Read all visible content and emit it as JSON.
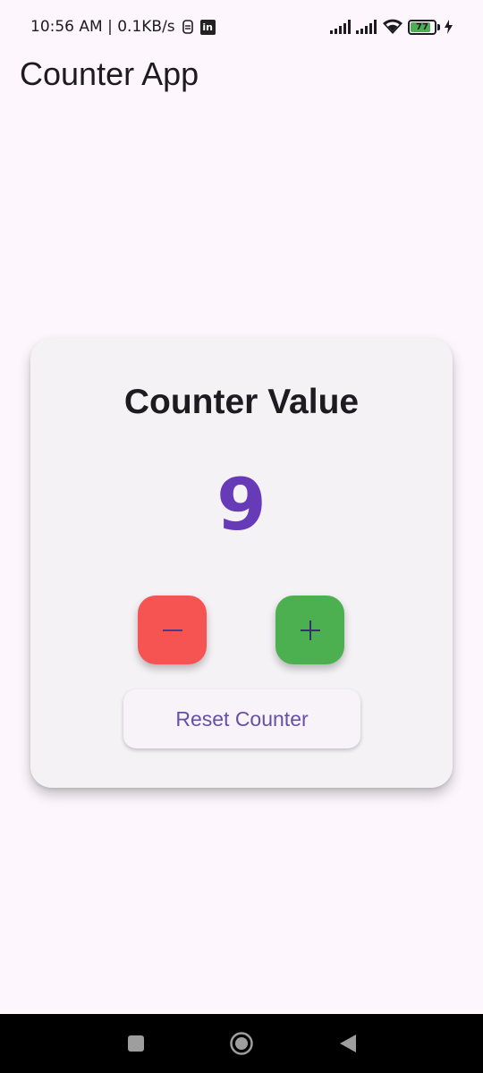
{
  "status_bar": {
    "time_and_speed": "10:56 AM | 0.1KB/s",
    "linkedin_glyph": "in",
    "battery_level": "77",
    "battery_fraction": 0.77,
    "icons": [
      "sim-icon",
      "linkedin-icon",
      "signal-icon",
      "signal-icon",
      "wifi-icon",
      "battery-icon",
      "charging-icon"
    ]
  },
  "app_bar": {
    "title": "Counter App"
  },
  "card": {
    "title": "Counter Value",
    "value": "9",
    "decrement_symbol": "−",
    "increment_symbol": "+",
    "reset_label": "Reset Counter"
  },
  "colors": {
    "background": "#fdf7fd",
    "card": "#f5f2f6",
    "value": "#673ab7",
    "decrement": "#f65353",
    "increment": "#4caf50",
    "reset_text": "#6750a4",
    "nav_bar": "#000000"
  },
  "nav_bar": {
    "icons": [
      "recent-apps-icon",
      "home-icon",
      "back-icon"
    ]
  }
}
